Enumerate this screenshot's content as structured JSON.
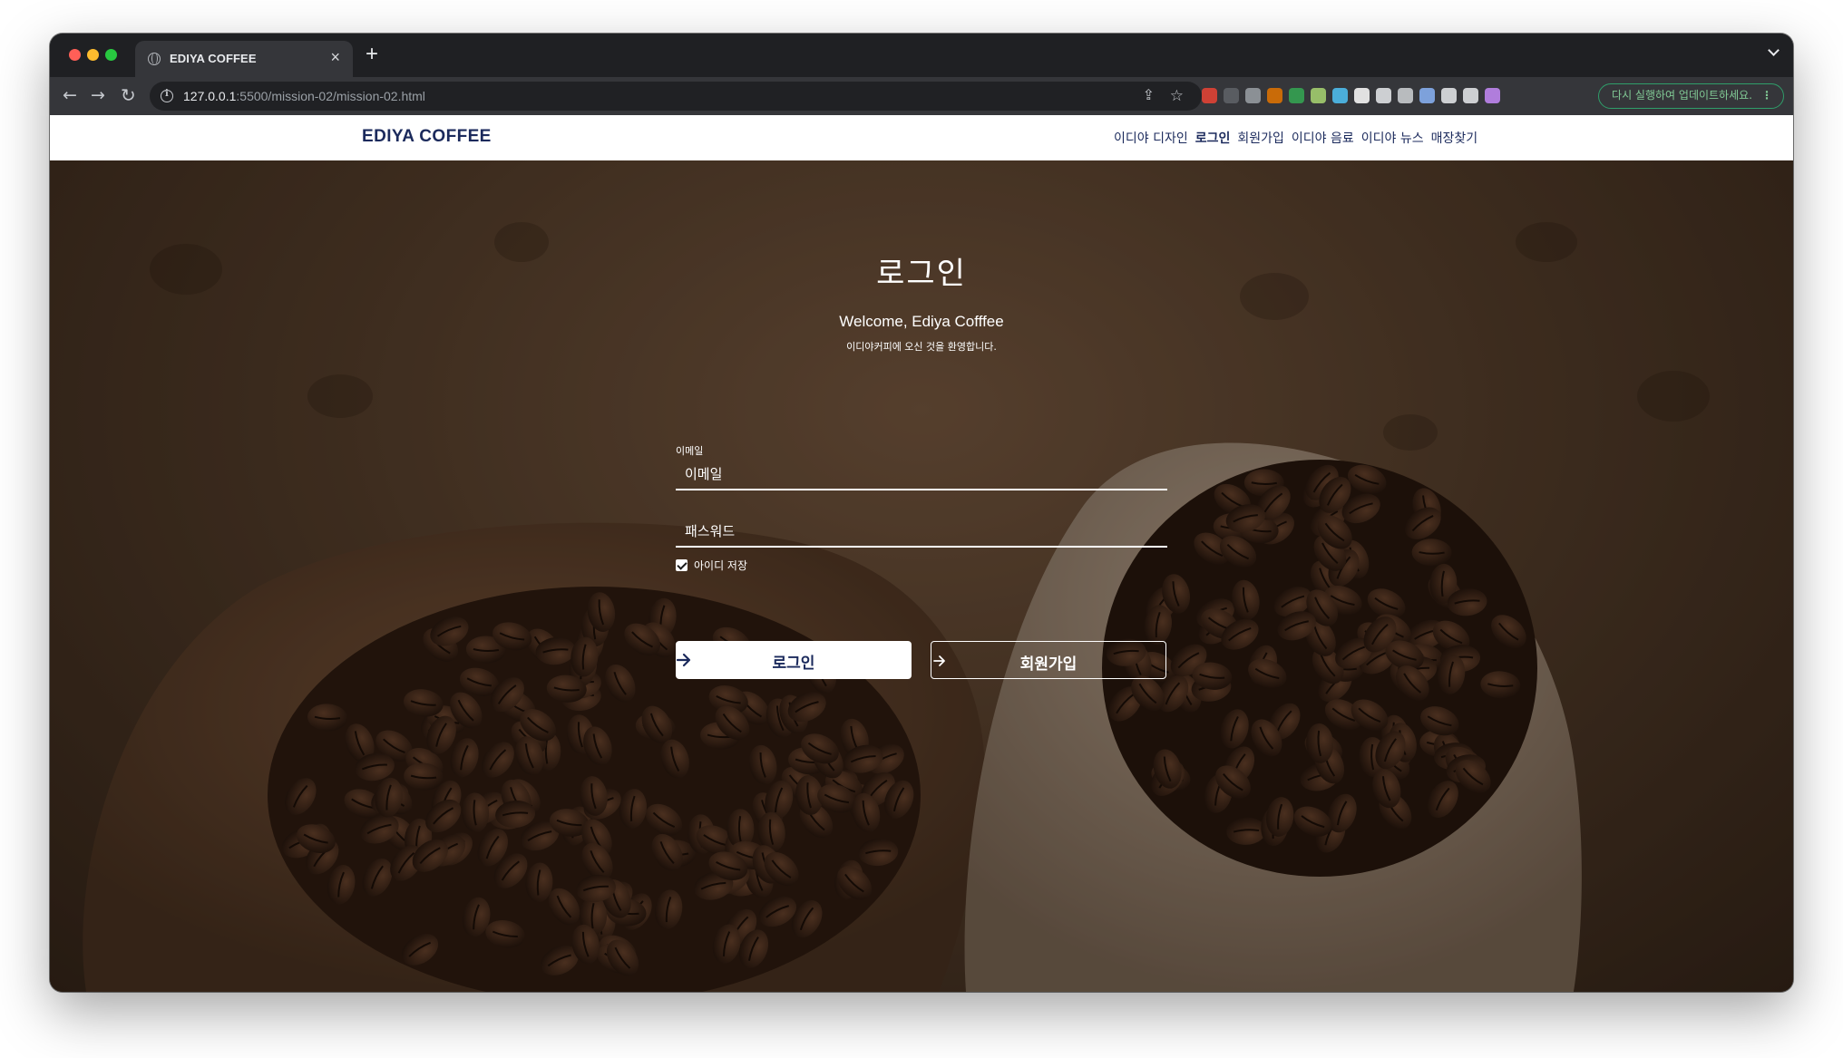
{
  "browser": {
    "tab_title": "EDIYA COFFEE",
    "tab_close": "×",
    "new_tab": "+",
    "url_host": "127.0.0.1",
    "url_path": ":5500/mission-02/mission-02.html",
    "update_label": "다시 실행하여 업데이트하세요.",
    "update_menu": "⋮",
    "back_glyph": "←",
    "forward_glyph": "→",
    "reload_glyph": "↻",
    "share_glyph": "⇪",
    "star_glyph": "☆",
    "extension_colors": [
      "#ea4335",
      "#5f6368",
      "#9aa0a6",
      "#e37400",
      "#34a853",
      "#a8d672",
      "#4fc3f7",
      "#ffffff",
      "#e8eaed",
      "#cfd2d6",
      "#8ab4f8",
      "#e8eaed",
      "#e8eaed",
      "#c58af9"
    ]
  },
  "site": {
    "logo": "EDIYA COFFEE",
    "nav": [
      "이디야 디자인",
      "로그인",
      "회원가입",
      "이디야 음료",
      "이디야 뉴스",
      "매장찾기"
    ],
    "active_nav_index": 1
  },
  "login": {
    "title": "로그인",
    "welcome": "Welcome, Ediya Cofffee",
    "welcome_ko": "이디야커피에 오신 것을 환영합니다.",
    "email_label": "이메일",
    "email_placeholder": "이메일",
    "password_placeholder": "패스워드",
    "remember_label": "아이디 저장",
    "remember_checked": true,
    "login_button": "로그인",
    "signup_button": "회원가입"
  },
  "colors": {
    "brand_navy": "#1b2a5c",
    "update_green": "#81c995"
  }
}
